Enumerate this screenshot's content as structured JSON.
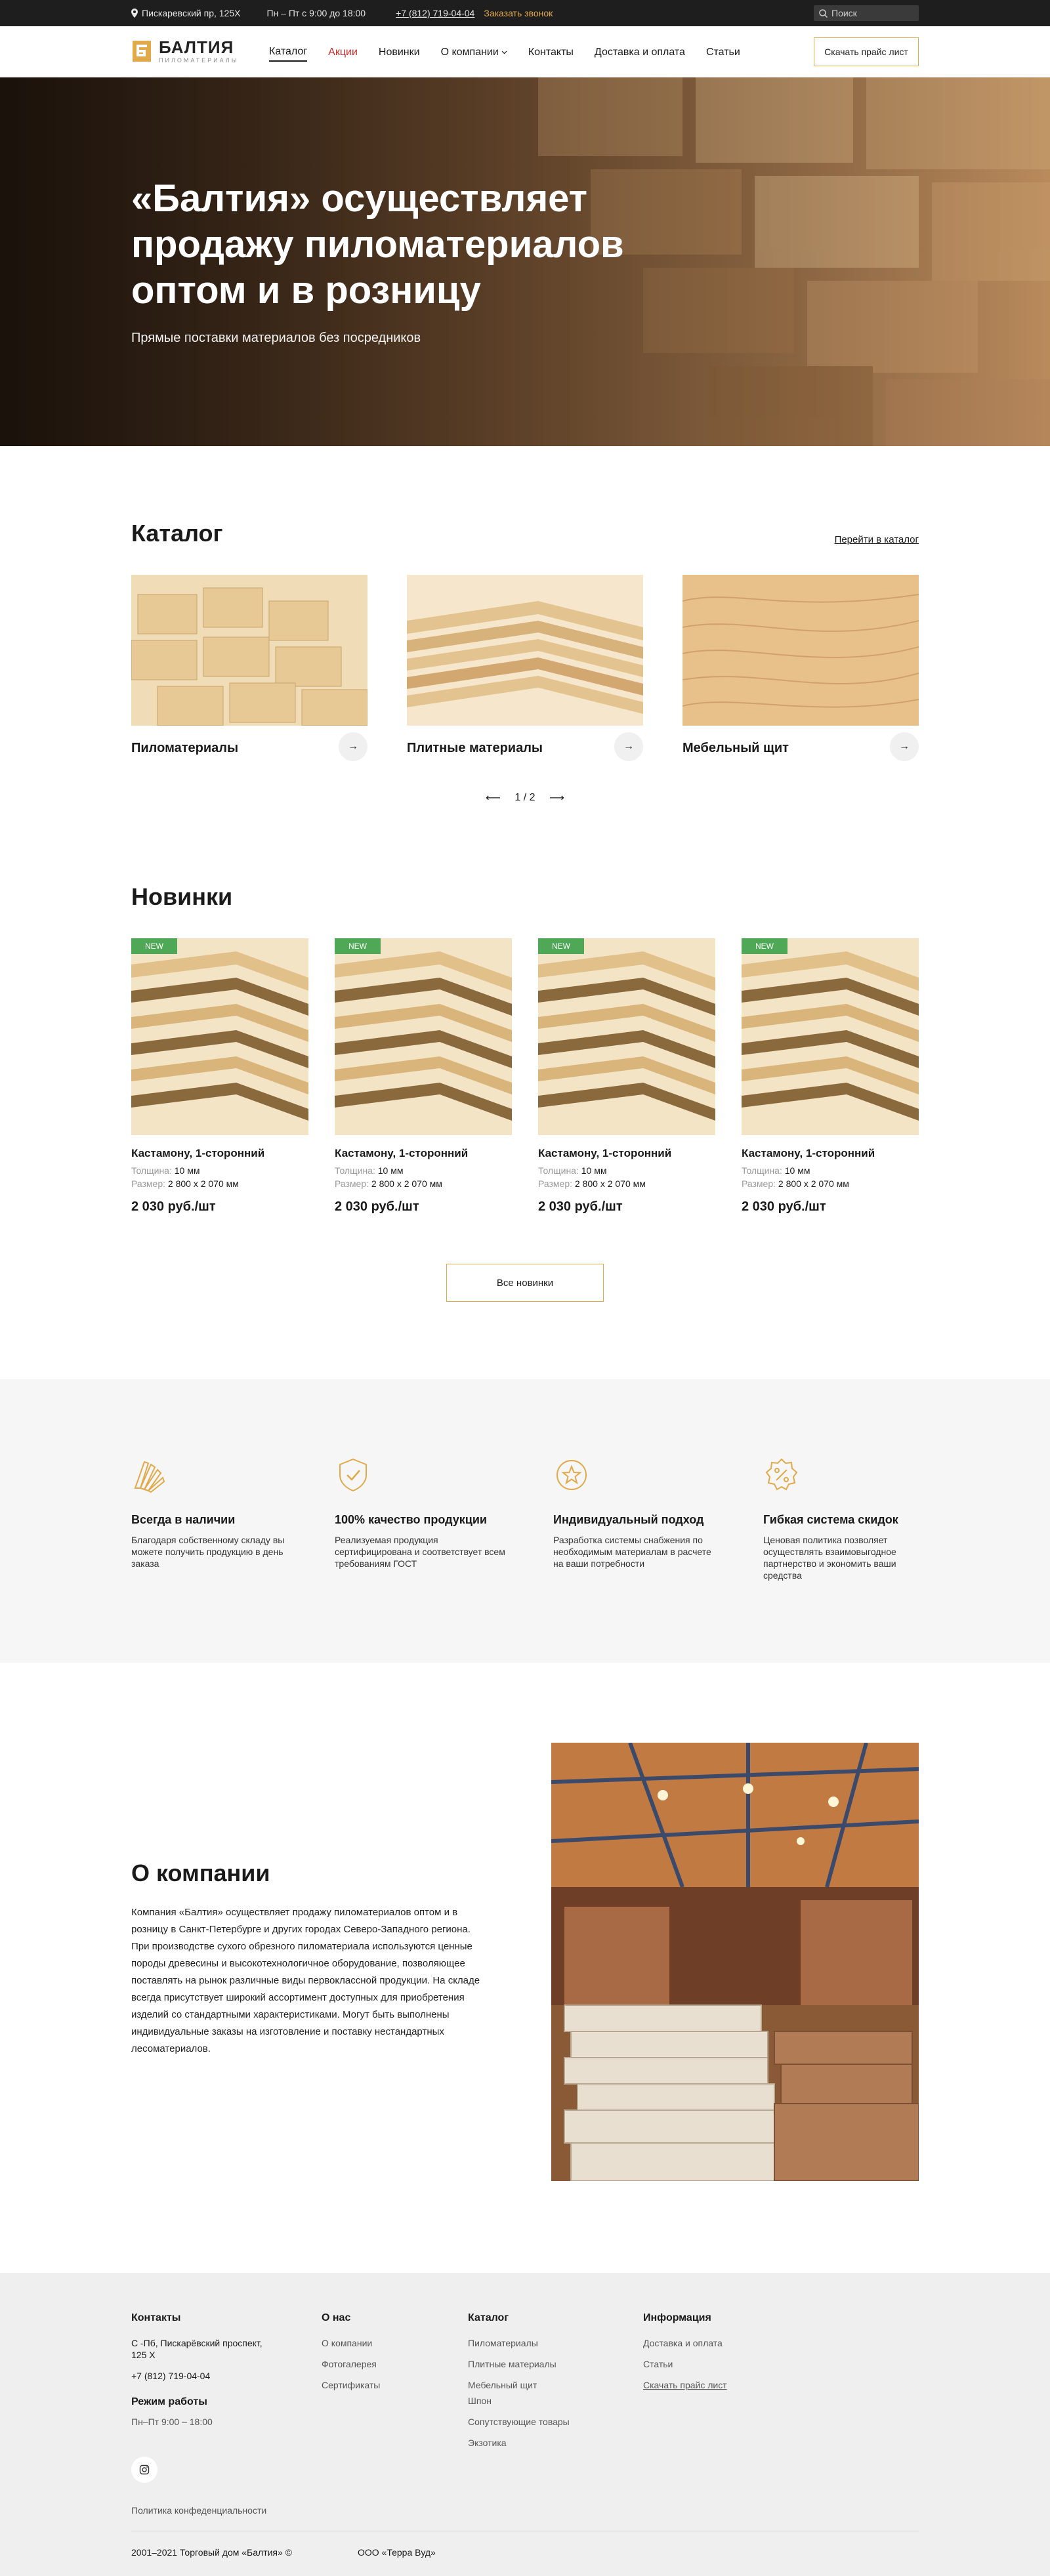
{
  "topbar": {
    "address": "Пискаревский пр, 125Х",
    "hours": "Пн – Пт с 9:00 до 18:00",
    "phone": "+7 (812) 719-04-04",
    "callback": "Заказать звонок",
    "search_placeholder": "Поиск"
  },
  "header": {
    "logo_title": "БАЛТИЯ",
    "logo_subtitle": "ПИЛОМАТЕРИАЛЫ",
    "nav": {
      "catalog": "Каталог",
      "sale": "Акции",
      "new": "Новинки",
      "about": "О компании",
      "contacts": "Контакты",
      "delivery": "Доставка и оплата",
      "articles": "Статьи"
    },
    "price_button": "Скачать прайс лист"
  },
  "hero": {
    "title": "«Балтия» осуществляет продажу пиломатериалов оптом и в розницу",
    "subtitle": "Прямые поставки материалов без посредников"
  },
  "catalog": {
    "title": "Каталог",
    "link": "Перейти в каталог",
    "items": [
      {
        "name": "Пиломатериалы"
      },
      {
        "name": "Плитные материалы"
      },
      {
        "name": "Мебельный щит"
      }
    ],
    "pager": "1 / 2"
  },
  "new_products": {
    "title": "Новинки",
    "badge": "NEW",
    "thickness_label": "Толщина:",
    "size_label": "Размер:",
    "items": [
      {
        "name": "Кастамону, 1-сторонний",
        "thickness": "10 мм",
        "size": "2 800 х 2 070 мм",
        "price": "2 030 руб./шт"
      },
      {
        "name": "Кастамону, 1-сторонний",
        "thickness": "10 мм",
        "size": "2 800 х 2 070 мм",
        "price": "2 030 руб./шт"
      },
      {
        "name": "Кастамону, 1-сторонний",
        "thickness": "10 мм",
        "size": "2 800 х 2 070 мм",
        "price": "2 030 руб./шт"
      },
      {
        "name": "Кастамону, 1-сторонний",
        "thickness": "10 мм",
        "size": "2 800 х 2 070 мм",
        "price": "2 030 руб./шт"
      }
    ],
    "all_button": "Все новинки"
  },
  "advantages": [
    {
      "icon": "wood-samples-icon",
      "title": "Всегда в наличии",
      "text": "Благодаря собственному складу вы можете получить продукцию в день заказа"
    },
    {
      "icon": "shield-check-icon",
      "title": "100% качество продукции",
      "text": "Реализуемая продукция сертифицирована и соответствует всем требованиям ГОСТ"
    },
    {
      "icon": "star-badge-icon",
      "title": "Индивидуальный подход",
      "text": "Разработка системы снабжения по необходимым материалам в расчете на ваши потребности"
    },
    {
      "icon": "percent-badge-icon",
      "title": "Гибкая система скидок",
      "text": "Ценовая политика позволяет осуществлять взаимовыгодное партнерство и экономить ваши средства"
    }
  ],
  "about": {
    "title": "О компании",
    "text": "Компания «Балтия» осуществляет продажу пиломатериалов оптом и в розницу в Санкт-Петербурге и других городах Северо-Западного региона. При производстве сухого обрезного пиломатериала используются ценные породы древесины и высокотехнологичное оборудование, позволяющее поставлять на рынок различные виды первоклассной продукции. На складе всегда присутствует широкий ассортимент доступных для приобретения изделий со стандартными характеристиками. Могут быть выполнены индивидуальные заказы на изготовление и поставку нестандартных лесоматериалов."
  },
  "footer": {
    "contacts_title": "Контакты",
    "address": "С -Пб, Пискарёвский проспект, 125 Х",
    "phone": "+7 (812) 719-04-04",
    "schedule_title": "Режим работы",
    "schedule": "Пн–Пт 9:00 – 18:00",
    "about_title": "О нас",
    "about_links": [
      "О компании",
      "Фотогалерея",
      "Сертификаты"
    ],
    "catalog_title": "Каталог",
    "catalog_links": [
      "Пиломатериалы",
      "Плитные материалы",
      "Мебельный щит",
      "Шпон",
      "Сопутствующие товары",
      "Экзотика"
    ],
    "info_title": "Информация",
    "info_links": [
      "Доставка и оплата",
      "Статьи",
      "Скачать прайс лист"
    ],
    "policy": "Политика конфеденциальности",
    "copyright": "2001–2021 Торговый дом «Балтия» ©",
    "company": "ООО «Терра Вуд»"
  },
  "colors": {
    "accent": "#e0a94a",
    "sale": "#d12a2a",
    "badge": "#4ea856",
    "topbar": "#1e1e1e"
  }
}
